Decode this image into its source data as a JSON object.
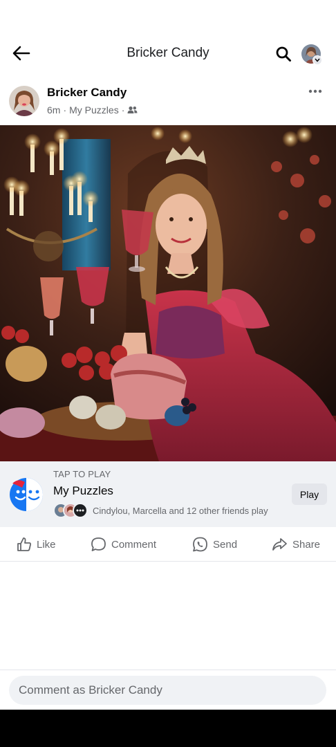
{
  "header": {
    "title": "Bricker Candy"
  },
  "post": {
    "author": "Bricker Candy",
    "time": "6m",
    "separator": "·",
    "group": "My Puzzles",
    "more_label": "•••"
  },
  "game": {
    "tap_label": "TAP TO PLAY",
    "title": "My Puzzles",
    "friends_text": "Cindylou, Marcella and 12 other friends play",
    "play_label": "Play"
  },
  "actions": {
    "like": "Like",
    "comment": "Comment",
    "send": "Send",
    "share": "Share"
  },
  "comment_box": {
    "placeholder": "Comment as Bricker Candy"
  },
  "colors": {
    "accent": "#1877f2",
    "secondary_text": "#65676b",
    "card_bg": "#f0f2f5"
  }
}
